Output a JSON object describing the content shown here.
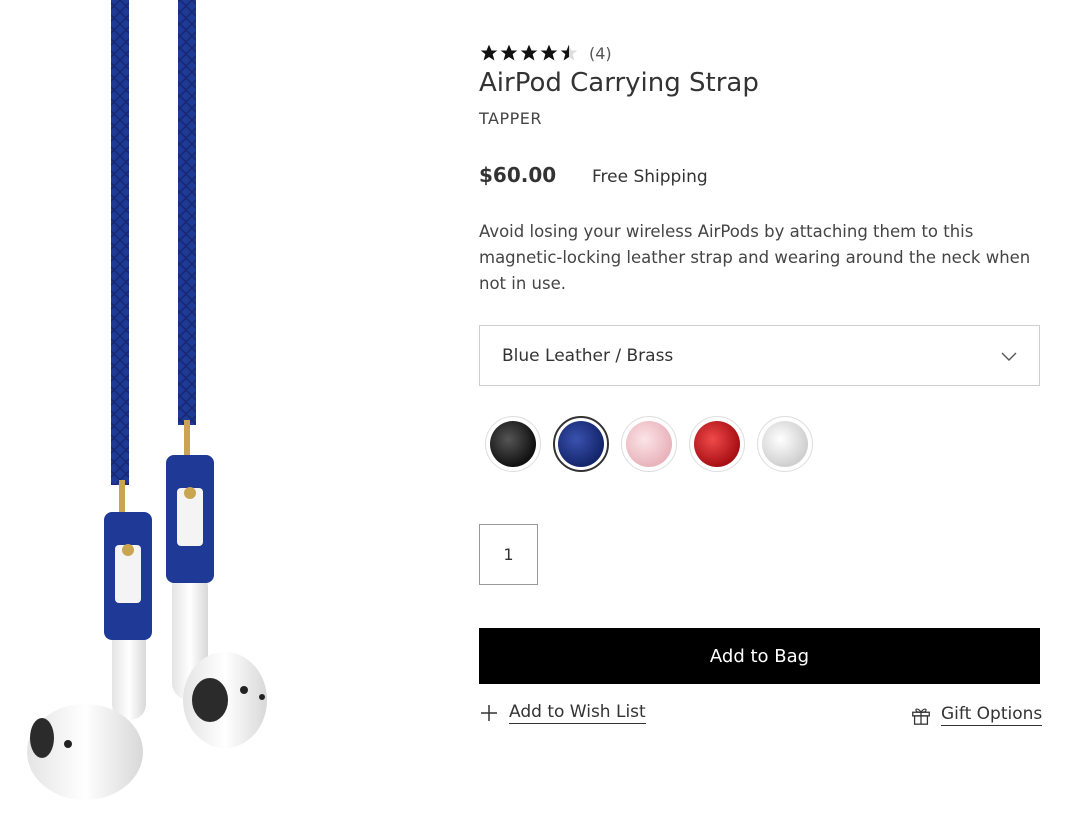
{
  "product": {
    "rating": 4.5,
    "review_count": "(4)",
    "title": "AirPod Carrying Strap",
    "brand": "TAPPER",
    "price": "$60.00",
    "shipping": "Free Shipping",
    "description": "Avoid losing your wireless AirPods by attaching them to this magnetic-locking leather strap and wearing around the neck when not in use.",
    "image_alt": "Blue leather AirPod strap with white AirPods"
  },
  "variant": {
    "selected_label": "Blue Leather / Brass",
    "swatches": [
      {
        "name": "black",
        "color": "#1a1a1a"
      },
      {
        "name": "blue",
        "color": "#1c2f7a"
      },
      {
        "name": "pink",
        "color": "#f1c6cc"
      },
      {
        "name": "red",
        "color": "#c8161c"
      },
      {
        "name": "white",
        "color": "#e9e9e9"
      }
    ],
    "selected_index": 1
  },
  "quantity": "1",
  "actions": {
    "add_to_bag": "Add to Bag",
    "wishlist": "Add to Wish List",
    "gift": "Gift Options"
  },
  "colors": {
    "strap_blue": "#1f3a96",
    "button_bg": "#000000",
    "brass": "#c9a552"
  }
}
